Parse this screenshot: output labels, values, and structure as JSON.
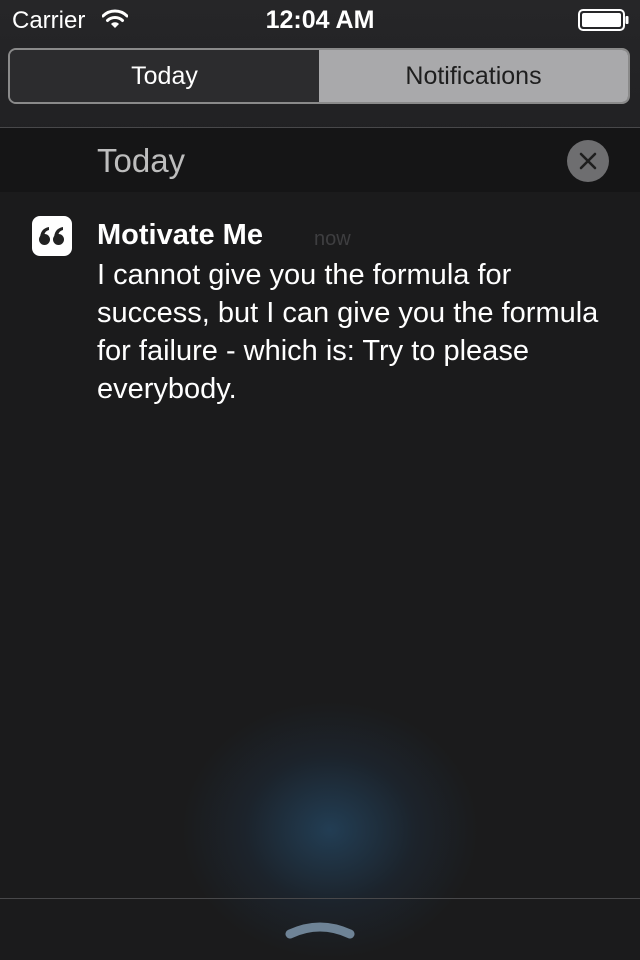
{
  "status_bar": {
    "carrier": "Carrier",
    "time": "12:04 AM",
    "wifi_icon": "wifi-icon",
    "battery_icon": "battery-icon"
  },
  "segmented_control": {
    "tabs": [
      {
        "label": "Today",
        "selected": true
      },
      {
        "label": "Notifications",
        "selected": false
      }
    ]
  },
  "section": {
    "title": "Today",
    "clear_icon": "close-icon"
  },
  "notification": {
    "app_icon": "quote-icon",
    "app_name": "Motivate Me",
    "time": "now",
    "message": "I cannot give you the formula for success, but I can give you the formula for failure - which is: Try to please everybody."
  },
  "footer": {
    "grabber_icon": "grabber-icon"
  },
  "colors": {
    "background": "#1b1b1c",
    "segment_selected": "#2c2c2e",
    "segment_unselected": "#a9a9ab",
    "clear_button": "#6e6e70"
  }
}
